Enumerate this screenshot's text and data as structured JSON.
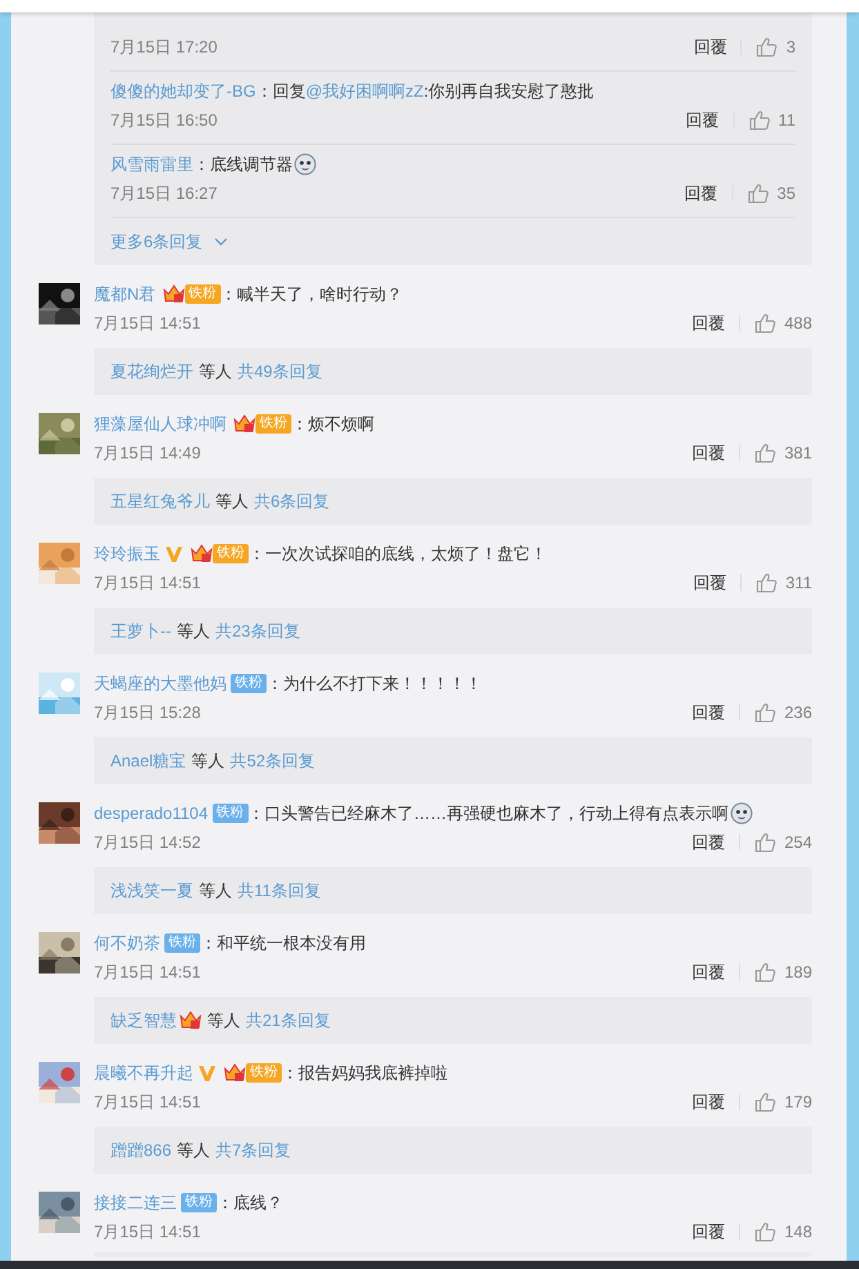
{
  "thread_replies": [
    {
      "time": "7月15日 17:20",
      "reply": "回覆",
      "likes": "3"
    },
    {
      "user": "傻傻的她却变了-BG",
      "text_before": "：回复",
      "mention": "@我好困啊啊zZ",
      "text": ":你别再自我安慰了憨批",
      "time": "7月15日 16:50",
      "reply": "回覆",
      "likes": "11"
    },
    {
      "user": "风雪雨雷里",
      "text": "：底线调节器",
      "emoji": true,
      "time": "7月15日 16:27",
      "reply": "回覆",
      "likes": "35"
    }
  ],
  "more_replies": "更多6条回复",
  "comments": [
    {
      "user": "魔都N君",
      "verified": false,
      "badge": {
        "kind": "crown",
        "label": "铁粉"
      },
      "text": "：喊半天了，啥时行动？",
      "emoji": false,
      "time": "7月15日 14:51",
      "reply": "回覆",
      "likes": "488",
      "summary": {
        "name": "夏花绚烂开",
        "name_icon": false,
        "middle": "等人",
        "total": "共49条回复"
      }
    },
    {
      "user": "狸藻屋仙人球冲啊",
      "verified": false,
      "badge": {
        "kind": "crown",
        "label": "铁粉"
      },
      "text": "：烦不烦啊",
      "emoji": false,
      "time": "7月15日 14:49",
      "reply": "回覆",
      "likes": "381",
      "summary": {
        "name": "五星红兔爷儿",
        "name_icon": false,
        "middle": "等人",
        "total": "共6条回复"
      }
    },
    {
      "user": "玲玲振玉",
      "verified": true,
      "badge": {
        "kind": "crown",
        "label": "铁粉"
      },
      "text": "：一次次试探咱的底线，太烦了！盘它！",
      "emoji": false,
      "time": "7月15日 14:51",
      "reply": "回覆",
      "likes": "311",
      "summary": {
        "name": "王萝卜--",
        "name_icon": false,
        "middle": "等人",
        "total": "共23条回复"
      }
    },
    {
      "user": "天蝎座的大墨他妈",
      "verified": false,
      "badge": {
        "kind": "plain",
        "label": "铁粉"
      },
      "text": "：为什么不打下来！！！！！",
      "emoji": false,
      "time": "7月15日 15:28",
      "reply": "回覆",
      "likes": "236",
      "summary": {
        "name": "Anael糖宝",
        "name_icon": false,
        "middle": "等人",
        "total": "共52条回复"
      }
    },
    {
      "user": "desperado1104",
      "verified": false,
      "badge": {
        "kind": "plain",
        "label": "铁粉"
      },
      "text": "：口头警告已经麻木了……再强硬也麻木了，行动上得有点表示啊",
      "emoji": true,
      "time": "7月15日 14:52",
      "reply": "回覆",
      "likes": "254",
      "summary": {
        "name": "浅浅笑一夏",
        "name_icon": false,
        "middle": "等人",
        "total": "共11条回复"
      }
    },
    {
      "user": "何不奶茶",
      "verified": false,
      "badge": {
        "kind": "plain",
        "label": "铁粉"
      },
      "text": "：和平统一根本没有用",
      "emoji": false,
      "time": "7月15日 14:51",
      "reply": "回覆",
      "likes": "189",
      "summary": {
        "name": "缺乏智慧",
        "name_icon": true,
        "middle": "等人",
        "total": "共21条回复"
      }
    },
    {
      "user": "晨曦不再升起",
      "verified": true,
      "badge": {
        "kind": "crown",
        "label": "铁粉"
      },
      "text": "：报告妈妈我底裤掉啦",
      "emoji": false,
      "time": "7月15日 14:51",
      "reply": "回覆",
      "likes": "179",
      "summary": {
        "name": "蹭蹭866",
        "name_icon": false,
        "middle": "等人",
        "total": "共7条回复"
      }
    },
    {
      "user": "接接二连三",
      "verified": false,
      "badge": {
        "kind": "plain",
        "label": "铁粉"
      },
      "text": "：底线？",
      "emoji": false,
      "time": "7月15日 14:51",
      "reply": "回覆",
      "likes": "148"
    }
  ]
}
